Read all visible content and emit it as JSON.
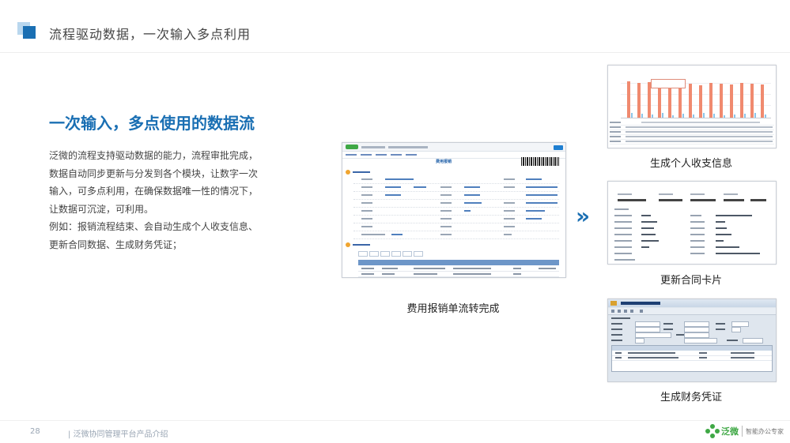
{
  "header": {
    "title": "流程驱动数据，一次输入多点利用"
  },
  "main": {
    "heading": "一次输入，多点使用的数据流",
    "paragraphs": [
      "泛微的流程支持驱动数据的能力，流程审批完成，数据自动同步更新与分发到各个模块，让数字一次输入，可多点利用，在确保数据唯一性的情况下，让数据可沉淀，可利用。",
      "例如：报销流程结束、会自动生成个人收支信息、更新合同数据、生成财务凭证；"
    ]
  },
  "expense_form": {
    "title": "费用报销",
    "caption": "费用报销单流转完成"
  },
  "arrow": {
    "glyph": "»"
  },
  "outputs": [
    {
      "caption": "生成个人收支信息"
    },
    {
      "caption": "更新合同卡片"
    },
    {
      "caption": "生成财务凭证"
    }
  ],
  "footer": {
    "page_number": "28",
    "text": "| 泛微协同管理平台产品介绍",
    "brand": "泛微",
    "slogan": "智能办公专家"
  },
  "colors": {
    "accent": "#1a6fb3",
    "brand_green": "#3fa845",
    "bar": "#f08a6f"
  }
}
